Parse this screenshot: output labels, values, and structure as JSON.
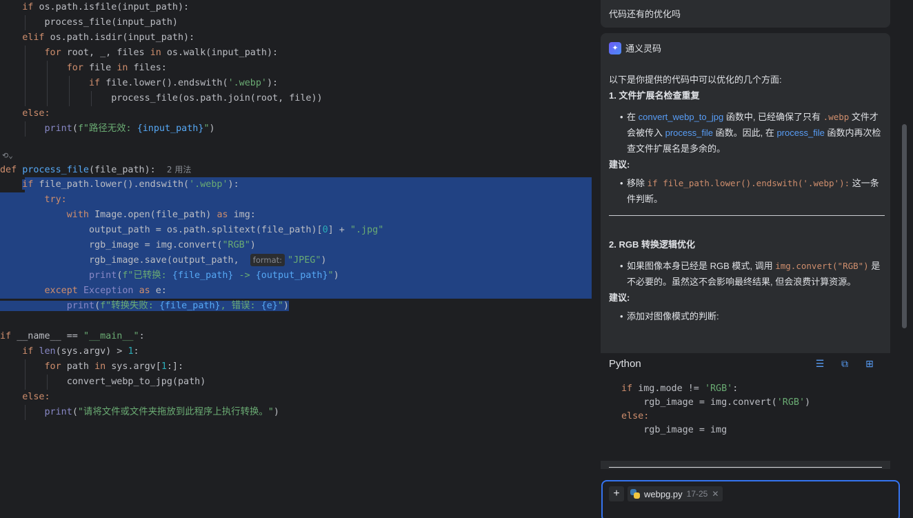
{
  "editor": {
    "code": {
      "l1": {
        "kw": "if ",
        "a": "os.path.isfile(input_path):"
      },
      "l2": "process_file(input_path)",
      "l3": {
        "kw": "elif ",
        "a": "os.path.isdir(input_path):"
      },
      "l4": {
        "kw1": "for ",
        "a": "root, _, files ",
        "kw2": "in ",
        "b": "os.walk(input_path):"
      },
      "l5": {
        "kw1": "for ",
        "a": "file ",
        "kw2": "in ",
        "b": "files:"
      },
      "l6": {
        "kw": "if ",
        "a": "file.lower().endswith(",
        "s": "'.webp'",
        "b": "):"
      },
      "l7": "process_file(os.path.join(root, file))",
      "l8": "else:",
      "l9": {
        "bi": "print",
        "a": "(",
        "s1": "f\"路径无效: ",
        "b": "{input_path}",
        "s2": "\"",
        "c": ")"
      },
      "l11": {
        "kw": "def ",
        "fn": "process_file",
        "a": "(file_path):",
        "usage": "2 用法"
      },
      "l12": {
        "kw": "if ",
        "a": "file_path.lower().endswith(",
        "s": "'.webp'",
        "b": "):"
      },
      "l13": "try:",
      "l14": {
        "kw1": "with ",
        "a": "Image.open(file_path) ",
        "kw2": "as ",
        "b": "img:"
      },
      "l15": {
        "a": "output_path = os.path.splitext(file_path)[",
        "n": "0",
        "b": "] + ",
        "s": "\".jpg\""
      },
      "l16": {
        "a": "rgb_image = img.convert(",
        "s": "\"RGB\"",
        "b": ")"
      },
      "l17": {
        "a": "rgb_image.save(output_path,",
        "hint": "format:",
        "s": "\"JPEG\"",
        "b": ")"
      },
      "l18": {
        "bi": "print",
        "a": "(",
        "s1": "f\"已转换: ",
        "b": "{file_path}",
        "s2": " -> ",
        "c": "{output_path}",
        "s3": "\"",
        "d": ")"
      },
      "l19": {
        "kw1": "except ",
        "cls": "Exception ",
        "kw2": "as ",
        "a": "e:"
      },
      "l20": {
        "bi": "print",
        "a": "(",
        "s1": "f\"转换失败: ",
        "b": "{file_path}",
        "s2": ", 错误: ",
        "c": "{e}",
        "s3": "\"",
        "d": ")"
      },
      "l22": {
        "kw": "if ",
        "a": "__name__ == ",
        "s": "\"__main__\"",
        "b": ":"
      },
      "l23": {
        "kw": "if ",
        "bi": "len",
        "a": "(sys.argv) > ",
        "n": "1",
        "b": ":"
      },
      "l24": {
        "kw1": "for ",
        "a": "path ",
        "kw2": "in ",
        "b": "sys.argv[",
        "n": "1",
        "c": ":]:"
      },
      "l25": "convert_webp_to_jpg(path)",
      "l26": "else:",
      "l27": {
        "bi": "print",
        "a": "(",
        "s": "\"请将文件或文件夹拖放到此程序上执行转换。\"",
        "b": ")"
      }
    }
  },
  "chat": {
    "user_question": "代码还有的优化吗",
    "assistant_name": "通义灵码",
    "intro": "以下是你提供的代码中可以优化的几个方面:",
    "section1": {
      "title": "1. 文件扩展名检查重复",
      "b1_a": "在 ",
      "b1_link1": "convert_webp_to_jpg",
      "b1_b": " 函数中, 已经确保了只有 ",
      "b1_code": ".webp",
      "b1_c": " 文件才会被传入 ",
      "b1_link2": "process_file",
      "b1_d": " 函数。因此, 在 ",
      "b1_link3": "process_file",
      "b1_e": " 函数内再次检查文件扩展名是多余的。",
      "suggest": "建议:",
      "b2_a": "移除 ",
      "b2_code": "if file_path.lower().endswith('.webp'):",
      "b2_b": " 这一条件判断。"
    },
    "section2": {
      "title": "2. RGB 转换逻辑优化",
      "b1_a": "如果图像本身已经是 RGB 模式, 调用 ",
      "b1_code": "img.convert(\"RGB\")",
      "b1_b": " 是不必要的。虽然这不会影响最终结果, 但会浪费计算资源。",
      "suggest": "建议:",
      "b2": "添加对图像模式的判断:"
    },
    "code_block": {
      "language": "Python",
      "line1_kw": "if ",
      "line1_a": "img.mode != ",
      "line1_s": "'RGB'",
      "line1_b": ":",
      "line2_a": "    rgb_image = img.convert(",
      "line2_s": "'RGB'",
      "line2_b": ")",
      "line3": "else:",
      "line4": "    rgb_image = img"
    },
    "input": {
      "file_name": "webpg.py",
      "file_range": "17-25"
    }
  }
}
